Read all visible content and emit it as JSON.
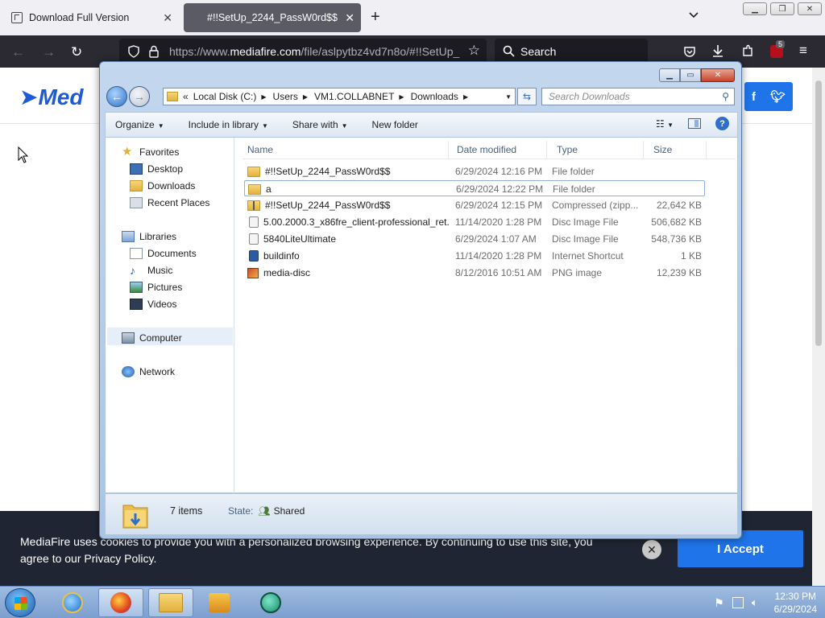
{
  "firefox": {
    "tabs": [
      {
        "label": "Download Full Version",
        "active": false
      },
      {
        "label": "#!!SetUp_2244_PassW0rd$$",
        "active": true
      }
    ],
    "url_prefix": "https://www.",
    "url_host": "mediafire.com",
    "url_path": "/file/aslpytbz4vd7n8o/#!!SetUp_",
    "search_placeholder": "Search",
    "extension_badge": "5"
  },
  "page": {
    "logo_text": "Med",
    "cookie_text": "MediaFire uses cookies to provide you with a personalized browsing experience. By continuing to use this site, you agree to our Privacy Policy.",
    "cookie_accept": "I Accept"
  },
  "explorer": {
    "breadcrumbs": [
      "Local Disk (C:)",
      "Users",
      "VM1.COLLABNET",
      "Downloads"
    ],
    "search_placeholder": "Search Downloads",
    "commands": [
      "Organize",
      "Include in library",
      "Share with",
      "New folder"
    ],
    "nav": {
      "favorites": "Favorites",
      "desktop": "Desktop",
      "downloads": "Downloads",
      "recent": "Recent Places",
      "libraries": "Libraries",
      "documents": "Documents",
      "music": "Music",
      "pictures": "Pictures",
      "videos": "Videos",
      "computer": "Computer",
      "network": "Network"
    },
    "columns": {
      "name": "Name",
      "date": "Date modified",
      "type": "Type",
      "size": "Size"
    },
    "files": [
      {
        "name": "#!!SetUp_2244_PassW0rd$$",
        "date": "6/29/2024 12:16 PM",
        "type": "File folder",
        "size": "",
        "icon": "folder-icon"
      },
      {
        "name": "a",
        "date": "6/29/2024 12:22 PM",
        "type": "File folder",
        "size": "",
        "icon": "folder-icon"
      },
      {
        "name": "#!!SetUp_2244_PassW0rd$$",
        "date": "6/29/2024 12:15 PM",
        "type": "Compressed (zipp...",
        "size": "22,642 KB",
        "icon": "zip-icon"
      },
      {
        "name": "5.00.2000.3_x86fre_client-professional_ret...",
        "date": "11/14/2020 1:28 PM",
        "type": "Disc Image File",
        "size": "506,682 KB",
        "icon": "disc-image-icon"
      },
      {
        "name": "5840LiteUltimate",
        "date": "6/29/2024 1:07 AM",
        "type": "Disc Image File",
        "size": "548,736 KB",
        "icon": "disc-image-icon"
      },
      {
        "name": "buildinfo",
        "date": "11/14/2020 1:28 PM",
        "type": "Internet Shortcut",
        "size": "1 KB",
        "icon": "shortcut-icon"
      },
      {
        "name": "media-disc",
        "date": "8/12/2016 10:51 AM",
        "type": "PNG image",
        "size": "12,239 KB",
        "icon": "png-icon"
      }
    ],
    "details": {
      "count": "7 items",
      "state_label": "State:",
      "state_value": "Shared"
    }
  },
  "taskbar": {
    "time": "12:30 PM",
    "date": "6/29/2024"
  }
}
